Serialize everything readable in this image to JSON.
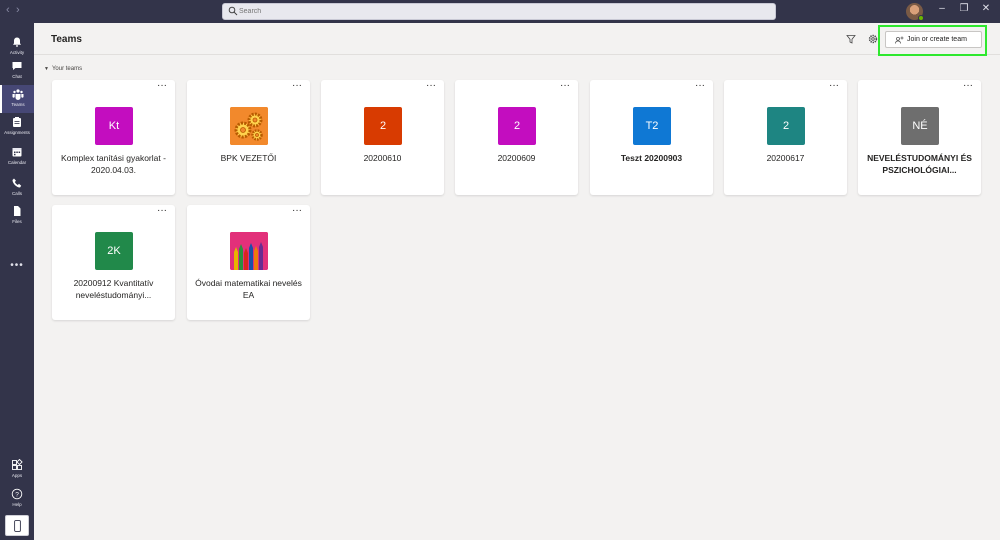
{
  "window": {
    "search_placeholder": "Search",
    "minimize": "–",
    "restore": "❐",
    "close": "✕"
  },
  "rail": {
    "items": [
      {
        "label": "Activity",
        "icon": "bell-icon"
      },
      {
        "label": "Chat",
        "icon": "chat-icon"
      },
      {
        "label": "Teams",
        "icon": "teams-icon"
      },
      {
        "label": "Assignments",
        "icon": "assignments-icon"
      },
      {
        "label": "Calendar",
        "icon": "calendar-icon"
      },
      {
        "label": "Calls",
        "icon": "phone-icon"
      },
      {
        "label": "Files",
        "icon": "file-icon"
      },
      {
        "label": "Apps",
        "icon": "apps-icon"
      },
      {
        "label": "Help",
        "icon": "help-icon"
      }
    ],
    "more": "•••"
  },
  "header": {
    "title": "Teams",
    "join_button": "Join or create team"
  },
  "section": {
    "label": "Your teams"
  },
  "teams": [
    {
      "tile": "Kt",
      "name": "Komplex tanítási gyakorlat - 2020.04.03.",
      "color": "#c30dbf"
    },
    {
      "tile": "",
      "name": "BPK VEZETŐI",
      "color": "#f2892c"
    },
    {
      "tile": "2",
      "name": "20200610",
      "color": "#d83b01"
    },
    {
      "tile": "2",
      "name": "20200609",
      "color": "#c30dbf"
    },
    {
      "tile": "T2",
      "name": "Teszt 20200903",
      "color": "#0f78d4"
    },
    {
      "tile": "2",
      "name": "20200617",
      "color": "#1e8582"
    },
    {
      "tile": "NÉ",
      "name": "NEVELÉSTUDOMÁNYI ÉS PSZICHOLÓGIAI...",
      "color": "#6e6e6e"
    },
    {
      "tile": "2K",
      "name": "20200912 Kvantitatív neveléstudományi...",
      "color": "#21894a"
    },
    {
      "tile": "",
      "name": "Óvodai matematikai nevelés EA",
      "color": "#e2307a"
    }
  ],
  "card_more": "···"
}
